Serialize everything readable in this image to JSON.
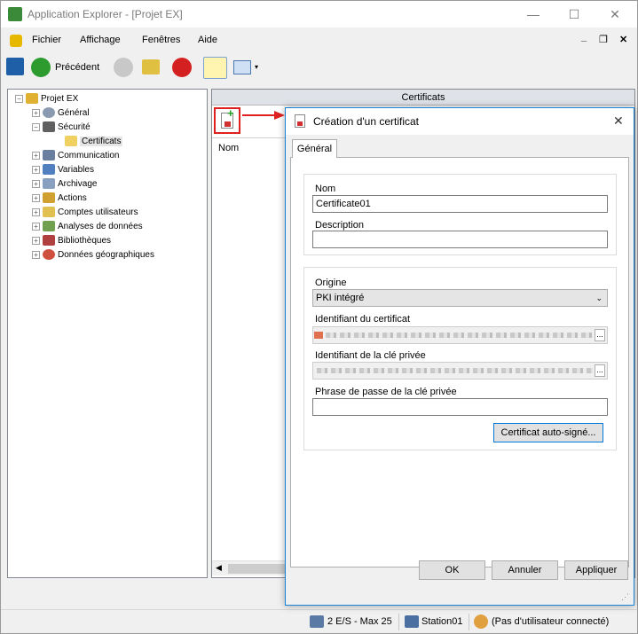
{
  "window": {
    "title": "Application Explorer - [Projet EX]",
    "minimize": "—",
    "maximize": "☐",
    "close": "✕"
  },
  "menu": {
    "items": [
      "Fichier",
      "Affichage",
      "Fenêtres",
      "Aide"
    ],
    "mdi_min": "_",
    "mdi_restore": "❐",
    "mdi_close": "✕"
  },
  "toolbar": {
    "back_label": "Précédent"
  },
  "tree": {
    "root": "Projet EX",
    "items": [
      "Général",
      "Sécurité",
      "Certificats",
      "Communication",
      "Variables",
      "Archivage",
      "Actions",
      "Comptes utilisateurs",
      "Analyses de données",
      "Bibliothèques",
      "Données géographiques"
    ]
  },
  "panel": {
    "header": "Certificats",
    "column_nom": "Nom"
  },
  "colors": {
    "accent": "#0078d7",
    "arrow": "#e02020",
    "highlight": "#e02020"
  },
  "dialog": {
    "title": "Création d'un certificat",
    "tab": "Général",
    "nom_label": "Nom",
    "nom_value": "Certificate01",
    "description_label": "Description",
    "description_value": "",
    "origine_label": "Origine",
    "origine_value": "PKI intégré",
    "cert_id_label": "Identifiant du certificat",
    "key_id_label": "Identifiant de la clé privée",
    "passphrase_label": "Phrase de passe de la clé privée",
    "passphrase_value": "",
    "browse": "...",
    "selfsigned_button": "Certificat auto-signé...",
    "ok": "OK",
    "cancel": "Annuler",
    "apply": "Appliquer"
  },
  "status": {
    "io": "2 E/S - Max 25",
    "station": "Station01",
    "user": "(Pas d'utilisateur connecté)"
  }
}
